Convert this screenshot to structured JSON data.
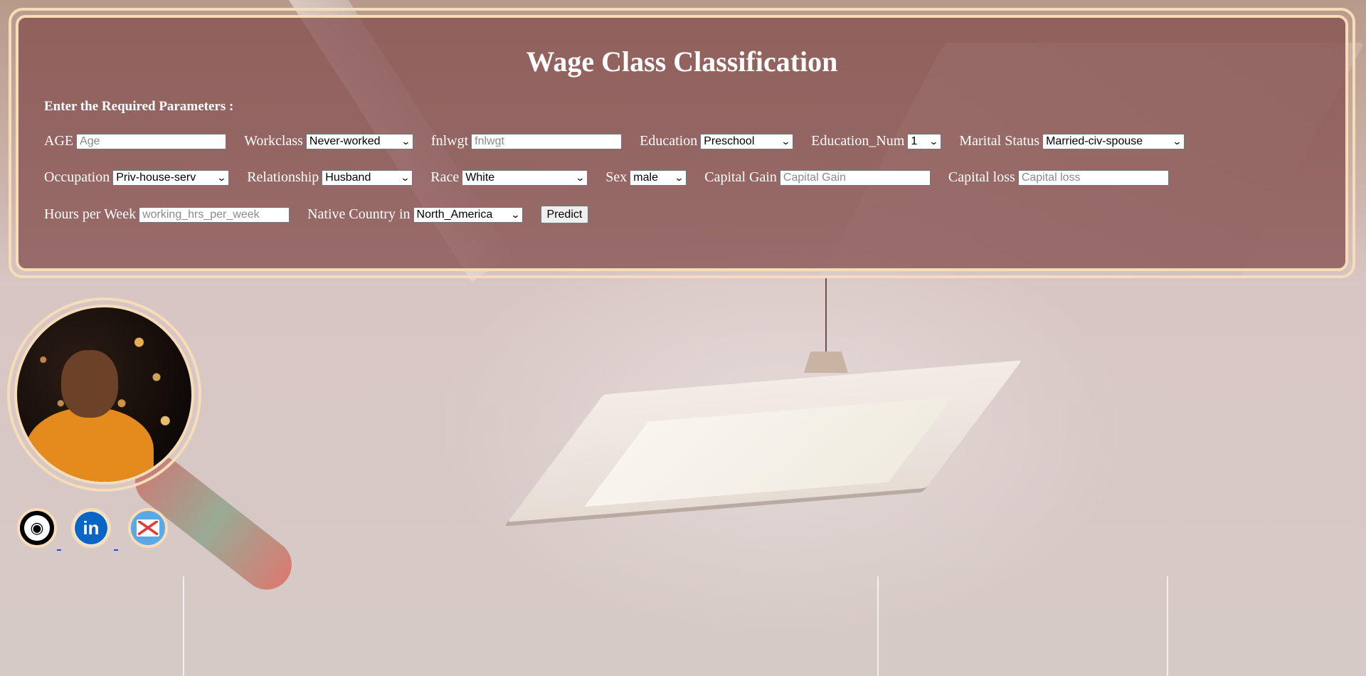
{
  "header": {
    "title": "Wage Class Classification",
    "subtitle": "Enter the Required Parameters :"
  },
  "form": {
    "age": {
      "label": "AGE",
      "placeholder": "Age"
    },
    "workclass": {
      "label": "Workclass",
      "selected": "Never-worked"
    },
    "fnlwgt": {
      "label": "fnlwgt",
      "placeholder": "fnlwgt"
    },
    "education": {
      "label": "Education",
      "selected": "Preschool"
    },
    "education_num": {
      "label": "Education_Num",
      "selected": "1"
    },
    "marital_status": {
      "label": "Marital Status",
      "selected": "Married-civ-spouse"
    },
    "occupation": {
      "label": "Occupation",
      "selected": "Priv-house-serv"
    },
    "relationship": {
      "label": "Relationship",
      "selected": "Husband"
    },
    "race": {
      "label": "Race",
      "selected": "White"
    },
    "sex": {
      "label": "Sex",
      "selected": "male"
    },
    "capital_gain": {
      "label": "Capital Gain",
      "placeholder": "Capital Gain"
    },
    "capital_loss": {
      "label": "Capital loss",
      "placeholder": "Capital loss"
    },
    "hours_per_week": {
      "label": "Hours per Week",
      "placeholder": "working_hrs_per_week"
    },
    "native_country": {
      "label": "Native Country in",
      "selected": "North_America"
    },
    "predict_label": "Predict"
  },
  "profile": {
    "social": {
      "github_icon": "github-icon",
      "linkedin_icon": "linkedin-icon",
      "gmail_icon": "gmail-icon",
      "linkedin_text": "in"
    }
  },
  "colors": {
    "panel_border": "#f6dcb7",
    "panel_bg": "#804a4a",
    "linkedin": "#0a66c2",
    "gmail_bg": "#5aa8e6"
  }
}
